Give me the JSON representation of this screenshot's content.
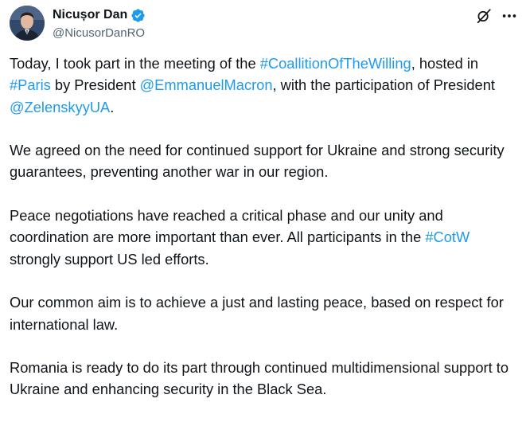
{
  "author": {
    "display_name": "Nicușor Dan",
    "handle": "@NicusorDanRO",
    "verified": true
  },
  "actions": {
    "icons": [
      "grok-icon",
      "more-icon"
    ]
  },
  "post": {
    "p1": {
      "t1": "Today, I took part in the meeting of the ",
      "tag_coalition": "#CoallitionOfTheWilling",
      "t2": ", hosted in ",
      "tag_paris": "#Paris",
      "t3": " by President ",
      "mention_macron": "@EmmanuelMacron",
      "t4": ", with the participation of President ",
      "mention_zelensky": "@ZelenskyyUA",
      "t5": "."
    },
    "p2": "We agreed on the need for continued support for Ukraine and strong security guarantees, preventing another war in our region.",
    "p3": {
      "t1": "Peace negotiations have reached a critical phase and our unity and coordination are more important than ever. All participants in the ",
      "tag_cotw": "#CotW",
      "t2": " strongly support US led efforts."
    },
    "p4": "Our common aim is to achieve a just and lasting peace, based on respect for international law.",
    "p5": "Romania is ready to do its part through continued multidimensional support to Ukraine and enhancing security in the Black Sea."
  },
  "colors": {
    "link": "#1d9bf0",
    "text": "#0f1419",
    "secondary": "#536471",
    "verified": "#1d9bf0"
  }
}
